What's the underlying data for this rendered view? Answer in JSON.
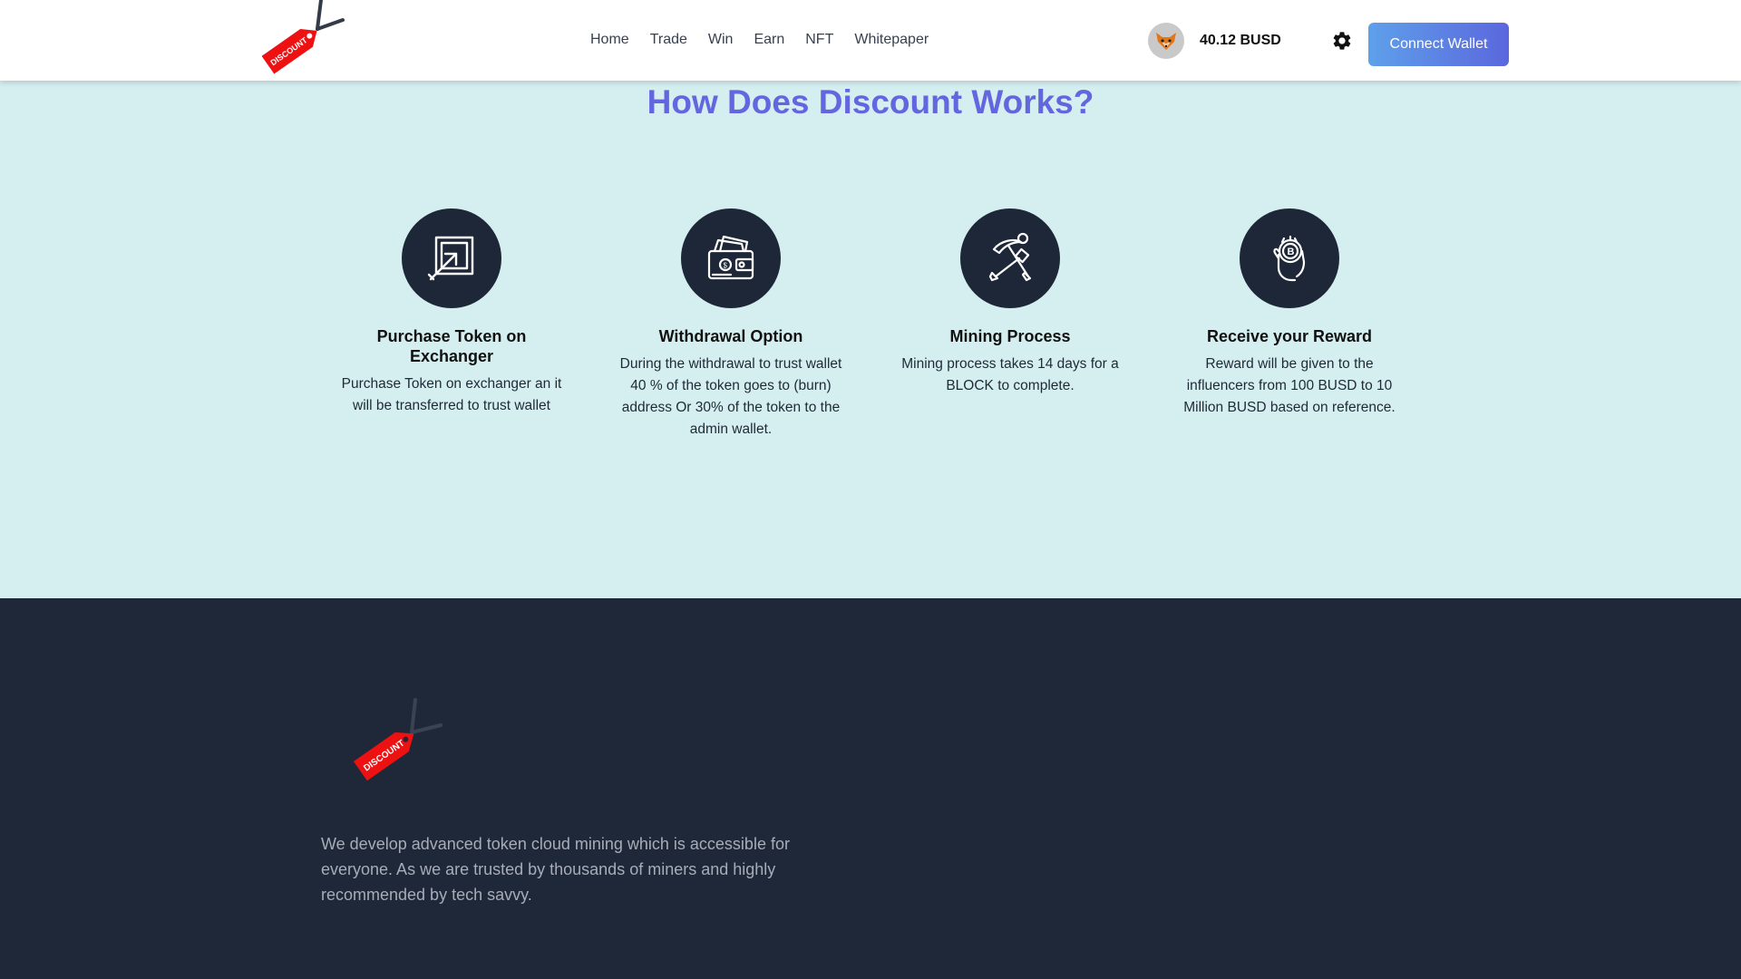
{
  "header": {
    "logo_text": "DISCOUNT",
    "nav": [
      {
        "label": "Home"
      },
      {
        "label": "Trade"
      },
      {
        "label": "Win"
      },
      {
        "label": "Earn"
      },
      {
        "label": "NFT"
      },
      {
        "label": "Whitepaper"
      }
    ],
    "avatar_icon": "fox-icon",
    "balance": "40.12 BUSD",
    "settings_icon": "gear-icon",
    "connect_label": "Connect Wallet"
  },
  "how_it_works": {
    "title": "How Does Discount Works?",
    "steps": [
      {
        "icon": "exchange-arrow-icon",
        "title": "Purchase Token on Exchanger",
        "description": "Purchase Token on exchanger an it will be transferred to trust wallet"
      },
      {
        "icon": "wallet-cash-icon",
        "title": "Withdrawal Option",
        "description": "During the withdrawal to trust wallet 40 % of the token goes to (burn) address Or 30% of the token to the admin wallet."
      },
      {
        "icon": "pickaxe-shovel-icon",
        "title": "Mining Process",
        "description": "Mining process takes 14 days for a BLOCK to complete."
      },
      {
        "icon": "hand-coin-icon",
        "title": "Receive your Reward",
        "description": "Reward will be given to the influencers from 100 BUSD to 10 Million BUSD based on reference."
      }
    ]
  },
  "footer": {
    "logo_text": "DISCOUNT",
    "description": "We develop advanced token cloud mining which is accessible for everyone. As we are trusted by thousands of miners and highly recommended by tech savvy."
  },
  "colors": {
    "accent_title": "#6466e0",
    "section_bg": "#d5eff0",
    "dark_bg": "#1f2838",
    "tag_red": "#ee1111",
    "button_gradient_start": "#5ea0ea",
    "button_gradient_end": "#5b67dd"
  }
}
